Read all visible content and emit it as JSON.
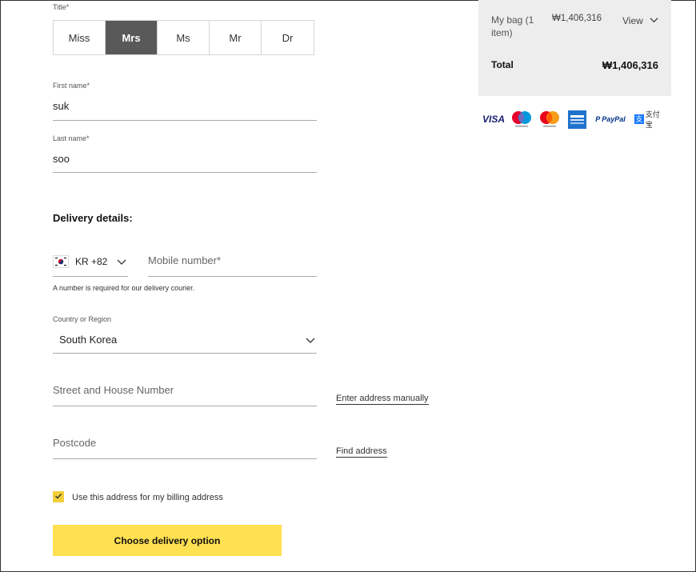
{
  "form": {
    "title_label": "Title*",
    "title_options": [
      "Miss",
      "Mrs",
      "Ms",
      "Mr",
      "Dr"
    ],
    "title_selected": "Mrs",
    "first_name_label": "First name*",
    "first_name_value": "suk",
    "last_name_label": "Last name*",
    "last_name_value": "soo",
    "delivery_heading": "Delivery details:",
    "phone_country": "KR +82",
    "mobile_placeholder": "Mobile number*",
    "mobile_hint": "A number is required for our delivery courier.",
    "country_label": "Country or Region",
    "country_value": "South Korea",
    "street_placeholder": "Street and House Number",
    "enter_manually_link": "Enter address manually",
    "postcode_placeholder": "Postcode",
    "find_address_link": "Find address",
    "billing_checkbox_label": "Use this address for my billing address",
    "billing_checked": true,
    "submit_label": "Choose delivery option"
  },
  "summary": {
    "bag_label": "My bag (1 item)",
    "bag_amount": "₩1,406,316",
    "view_label": "View",
    "total_label": "Total",
    "total_amount": "₩1,406,316"
  },
  "payment_methods": {
    "visa": "VISA",
    "paypal": "PayPal",
    "alipay": "支付宝"
  },
  "colors": {
    "accent_yellow": "#ffe050",
    "selected_dark": "#595959",
    "summary_bg": "#ededed"
  }
}
